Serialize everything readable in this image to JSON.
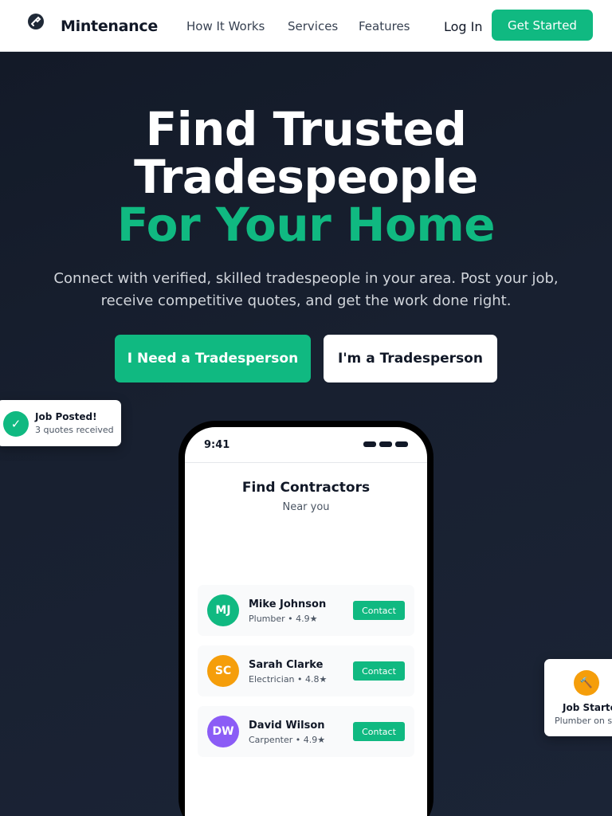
{
  "brand": {
    "name": "Mintenance",
    "icon": "wrench-logo-icon"
  },
  "nav": {
    "links": [
      "How It Works",
      "Services",
      "Features"
    ],
    "login": "Log In",
    "cta": "Get Started"
  },
  "hero": {
    "title_line1": "Find Trusted",
    "title_line2": "Tradespeople",
    "title_line3": "For Your Home",
    "subtitle_line1": "Connect with verified, skilled tradespeople in your area. Post your job,",
    "subtitle_line2": "receive competitive quotes, and get the work done right.",
    "primary_button": "I Need a Tradesperson",
    "secondary_button": "I'm a Tradesperson"
  },
  "notifications": {
    "left": {
      "title": "Job Posted!",
      "subtitle": "3 quotes received",
      "icon": "check-icon",
      "icon_glyph": "✓"
    },
    "right": {
      "title": "Job Started",
      "subtitle": "Plumber on site",
      "icon": "hammer-icon",
      "icon_glyph": "🔨"
    }
  },
  "phone": {
    "time": "9:41",
    "screen_title": "Find Contractors",
    "screen_subtitle": "Near you",
    "contractors": [
      {
        "initials": "MJ",
        "name": "Mike Johnson",
        "role": "Plumber • 4.9★",
        "color": "#10b981",
        "action": "Contact"
      },
      {
        "initials": "SC",
        "name": "Sarah Clarke",
        "role": "Electrician • 4.8★",
        "color": "#f59e0b",
        "action": "Contact"
      },
      {
        "initials": "DW",
        "name": "David Wilson",
        "role": "Carpenter • 4.9★",
        "color": "#8b5cf6",
        "action": "Contact"
      }
    ]
  },
  "colors": {
    "accent": "#10b981",
    "dark_bg": "#18202f",
    "warning": "#f59e0b",
    "purple": "#8b5cf6"
  }
}
